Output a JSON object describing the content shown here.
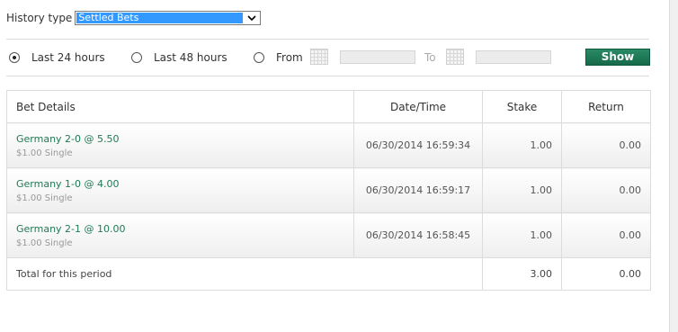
{
  "history": {
    "label": "History type",
    "selected": "Settled Bets"
  },
  "filters": {
    "options": [
      {
        "label": "Last 24 hours",
        "checked": true
      },
      {
        "label": "Last 48 hours",
        "checked": false
      },
      {
        "label": "From",
        "checked": false
      }
    ],
    "to_label": "To",
    "show_label": "Show"
  },
  "table": {
    "headers": {
      "details": "Bet Details",
      "datetime": "Date/Time",
      "stake": "Stake",
      "return": "Return"
    },
    "rows": [
      {
        "selection": "Germany 2-0 @ 5.50",
        "sub": "$1.00  Single",
        "datetime": "06/30/2014 16:59:34",
        "stake": "1.00",
        "return": "0.00"
      },
      {
        "selection": "Germany 1-0 @ 4.00",
        "sub": "$1.00  Single",
        "datetime": "06/30/2014 16:59:17",
        "stake": "1.00",
        "return": "0.00"
      },
      {
        "selection": "Germany 2-1 @ 10.00",
        "sub": "$1.00  Single",
        "datetime": "06/30/2014 16:58:45",
        "stake": "1.00",
        "return": "0.00"
      }
    ],
    "total": {
      "label": "Total for this period",
      "stake": "3.00",
      "return": "0.00"
    }
  },
  "colors": {
    "accent_green": "#15694a",
    "selection_text": "#1f7a55",
    "select_highlight": "#3399ff"
  }
}
